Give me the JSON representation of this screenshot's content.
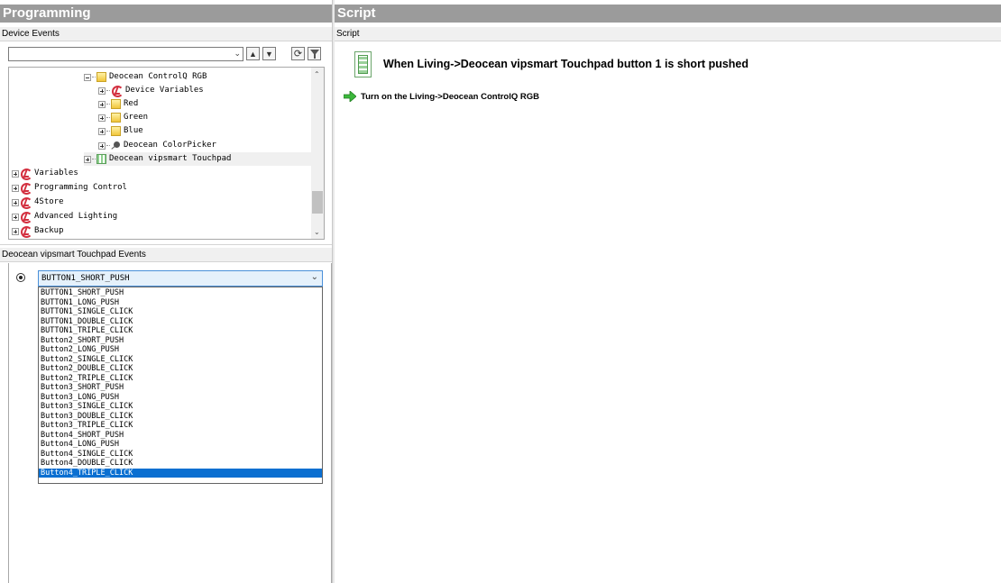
{
  "left_panel": {
    "title": "Programming",
    "device_events_label": "Device Events",
    "search_value": "",
    "tree": [
      {
        "label": "Deocean ControlQ RGB",
        "icon": "folder-device-icon",
        "expander": "minus"
      },
      {
        "label": "Device Variables",
        "icon": "4store-logo-icon",
        "expander": "plus"
      },
      {
        "label": "Red",
        "icon": "folder-device-icon",
        "expander": "plus"
      },
      {
        "label": "Green",
        "icon": "folder-device-icon",
        "expander": "plus"
      },
      {
        "label": "Blue",
        "icon": "folder-device-icon",
        "expander": "plus"
      },
      {
        "label": "Deocean ColorPicker",
        "icon": "color-picker-icon",
        "expander": "plus"
      },
      {
        "label": "Deocean vipsmart Touchpad",
        "icon": "touchpad-grid-icon",
        "expander": "plus",
        "highlighted": true
      },
      {
        "label": "Variables",
        "icon": "4store-logo-icon",
        "expander": "plus"
      },
      {
        "label": "Programming Control",
        "icon": "4store-logo-icon",
        "expander": "plus"
      },
      {
        "label": "4Store",
        "icon": "4store-logo-icon",
        "expander": "plus"
      },
      {
        "label": "Advanced Lighting",
        "icon": "4store-logo-icon",
        "expander": "plus"
      },
      {
        "label": "Backup",
        "icon": "4store-logo-icon",
        "expander": "plus"
      }
    ],
    "events_label": "Deocean vipsmart Touchpad Events",
    "event_select": {
      "selected": "BUTTON1_SHORT_PUSH",
      "options": [
        "BUTTON1_SHORT_PUSH",
        "BUTTON1_LONG_PUSH",
        "BUTTON1_SINGLE_CLICK",
        "BUTTON1_DOUBLE_CLICK",
        "BUTTON1_TRIPLE_CLICK",
        "Button2_SHORT_PUSH",
        "Button2_LONG_PUSH",
        "Button2_SINGLE_CLICK",
        "Button2_DOUBLE_CLICK",
        "Button2_TRIPLE_CLICK",
        "Button3_SHORT_PUSH",
        "Button3_LONG_PUSH",
        "Button3_SINGLE_CLICK",
        "Button3_DOUBLE_CLICK",
        "Button3_TRIPLE_CLICK",
        "Button4_SHORT_PUSH",
        "Button4_LONG_PUSH",
        "Button4_SINGLE_CLICK",
        "Button4_DOUBLE_CLICK",
        "Button4_TRIPLE_CLICK"
      ],
      "highlighted_option": "Button4_TRIPLE_CLICK"
    }
  },
  "right_panel": {
    "title": "Script",
    "subheader": "Script",
    "when_text": "When Living->Deocean vipsmart Touchpad button 1 is short pushed",
    "action_text": "Turn on the Living->Deocean ControlQ RGB"
  },
  "colors": {
    "header_bg": "#9b9b9b",
    "selection": "#0a6fd1",
    "action_arrow": "#3cb83c"
  }
}
